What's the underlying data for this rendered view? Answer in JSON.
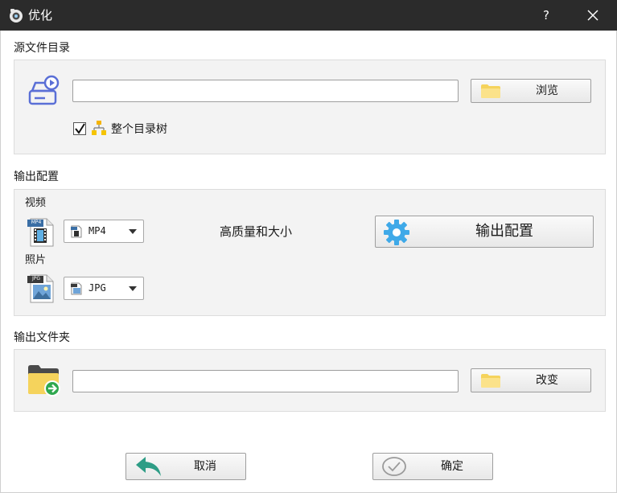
{
  "titlebar": {
    "title": "优化",
    "help": "?"
  },
  "source": {
    "section_title": "源文件目录",
    "path_value": "",
    "browse_label": "浏览",
    "whole_tree_label": "整个目录树",
    "whole_tree_checked": true
  },
  "output_config": {
    "section_title": "输出配置",
    "video_label": "视频",
    "video_icon_tag": "MP4",
    "video_format": "MP4",
    "quality_text": "高质量和大小",
    "config_button_label": "输出配置",
    "photo_label": "照片",
    "photo_icon_tag": "JPG",
    "photo_format": "JPG"
  },
  "output_folder": {
    "section_title": "输出文件夹",
    "path_value": "",
    "change_label": "改变"
  },
  "footer": {
    "cancel_label": "取消",
    "ok_label": "确定"
  },
  "colors": {
    "titlebar": "#2b2b2b",
    "panel": "#f3f3f3",
    "accent_blue": "#5a6fd6",
    "gear_blue": "#3fa9e8",
    "cancel_green": "#2e9d86",
    "folder_yellow": "#f5d35c"
  }
}
